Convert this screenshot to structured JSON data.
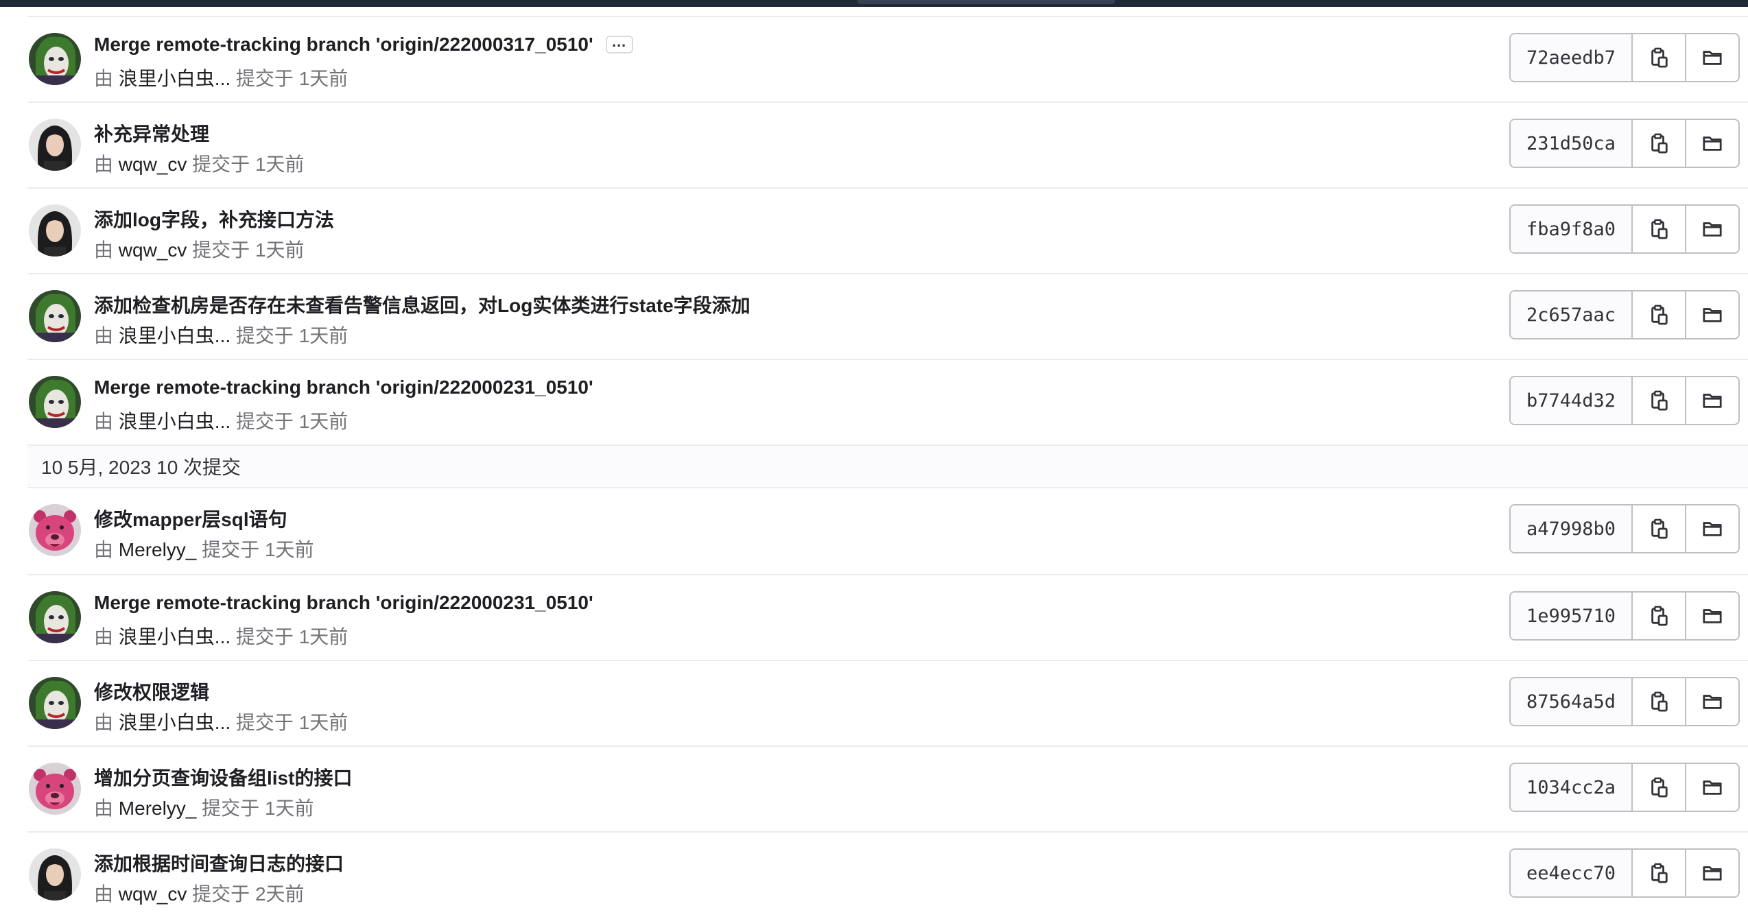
{
  "colors": {
    "topbar": "#1f2937",
    "border": "#ececef",
    "text": "#1f1e24",
    "muted": "#737278"
  },
  "icons": {
    "copy": "copy-icon",
    "browse": "folder-icon",
    "more": "ellipsis-icon"
  },
  "groups": [
    {
      "header": null,
      "commits": [
        {
          "title": "Merge remote-tracking branch 'origin/222000317_0510'",
          "by": "由",
          "author": "浪里小白虫...",
          "time": "提交于 1天前",
          "sha": "72aeedb7",
          "avatar": "joker",
          "has_more": true
        },
        {
          "title": "补充异常处理",
          "by": "由",
          "author": "wqw_cv",
          "time": "提交于 1天前",
          "sha": "231d50ca",
          "avatar": "woman",
          "has_more": false
        },
        {
          "title": "添加log字段，补充接口方法",
          "by": "由",
          "author": "wqw_cv",
          "time": "提交于 1天前",
          "sha": "fba9f8a0",
          "avatar": "woman",
          "has_more": false
        },
        {
          "title": "添加检查机房是否存在未查看告警信息返回，对Log实体类进行state字段添加",
          "by": "由",
          "author": "浪里小白虫...",
          "time": "提交于 1天前",
          "sha": "2c657aac",
          "avatar": "joker",
          "has_more": false
        },
        {
          "title": "Merge remote-tracking branch 'origin/222000231_0510'",
          "by": "由",
          "author": "浪里小白虫...",
          "time": "提交于 1天前",
          "sha": "b7744d32",
          "avatar": "joker",
          "has_more": false
        }
      ]
    },
    {
      "header": "10 5月, 2023 10 次提交",
      "commits": [
        {
          "title": "修改mapper层sql语句",
          "by": "由",
          "author": "Merelyy_",
          "time": "提交于 1天前",
          "sha": "a47998b0",
          "avatar": "bear",
          "has_more": false
        },
        {
          "title": "Merge remote-tracking branch 'origin/222000231_0510'",
          "by": "由",
          "author": "浪里小白虫...",
          "time": "提交于 1天前",
          "sha": "1e995710",
          "avatar": "joker",
          "has_more": false
        },
        {
          "title": "修改权限逻辑",
          "by": "由",
          "author": "浪里小白虫...",
          "time": "提交于 1天前",
          "sha": "87564a5d",
          "avatar": "joker",
          "has_more": false
        },
        {
          "title": "增加分页查询设备组list的接口",
          "by": "由",
          "author": "Merelyy_",
          "time": "提交于 1天前",
          "sha": "1034cc2a",
          "avatar": "bear",
          "has_more": false
        },
        {
          "title": "添加根据时间查询日志的接口",
          "by": "由",
          "author": "wqw_cv",
          "time": "提交于 2天前",
          "sha": "ee4ecc70",
          "avatar": "woman",
          "has_more": false
        }
      ]
    }
  ]
}
